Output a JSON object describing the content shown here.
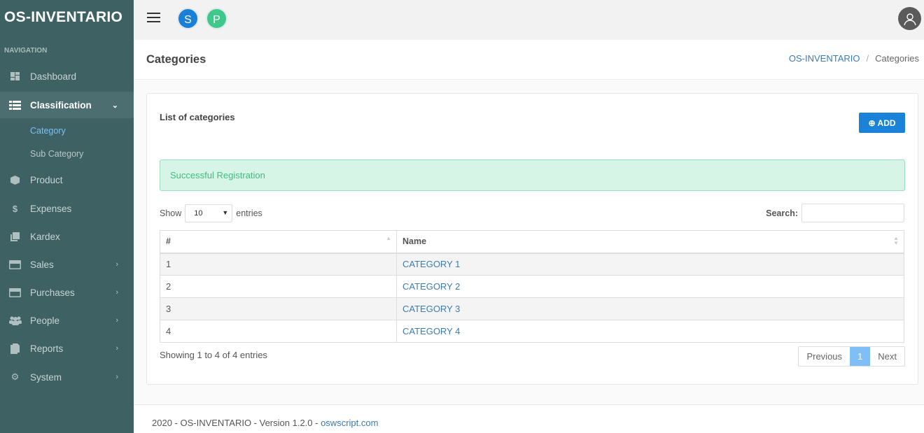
{
  "brand": "OS-INVENTARIO",
  "sidebar": {
    "header": "NAVIGATION",
    "items": [
      {
        "label": "Dashboard",
        "icon": "dashboard-icon"
      },
      {
        "label": "Classification",
        "icon": "list-icon",
        "active": true
      },
      {
        "label": "Product",
        "icon": "cube-icon"
      },
      {
        "label": "Expenses",
        "icon": "dollar-icon"
      },
      {
        "label": "Kardex",
        "icon": "book-icon"
      },
      {
        "label": "Sales",
        "icon": "credit-card-icon"
      },
      {
        "label": "Purchases",
        "icon": "credit-card-icon"
      },
      {
        "label": "People",
        "icon": "users-icon"
      },
      {
        "label": "Reports",
        "icon": "file-icon"
      },
      {
        "label": "System",
        "icon": "gear-icon"
      }
    ],
    "subitems": [
      {
        "label": "Category",
        "active": true
      },
      {
        "label": "Sub Category"
      }
    ]
  },
  "topbar": {
    "avatars": [
      {
        "letter": "S",
        "color": "#1a7fd6"
      },
      {
        "letter": "P",
        "color": "#3ec98a"
      }
    ]
  },
  "page": {
    "title": "Categories",
    "breadcrumb": [
      "OS-INVENTARIO",
      "Categories"
    ]
  },
  "card": {
    "title": "List of categories",
    "add_label": "ADD",
    "alert": "Successful Registration",
    "show_label": "Show",
    "entries_label": "entries",
    "page_length": "10",
    "search_label": "Search:",
    "search_value": "",
    "columns": [
      "#",
      "Name"
    ],
    "rows": [
      [
        "1",
        "CATEGORY 1"
      ],
      [
        "2",
        "CATEGORY 2"
      ],
      [
        "3",
        "CATEGORY 3"
      ],
      [
        "4",
        "CATEGORY 4"
      ]
    ],
    "info": "Showing 1 to 4 of 4 entries",
    "pager": {
      "prev": "Previous",
      "current": "1",
      "next": "Next"
    }
  },
  "footer": {
    "text": "2020 - OS-INVENTARIO - Version 1.2.0 - ",
    "link": "oswscript.com"
  }
}
